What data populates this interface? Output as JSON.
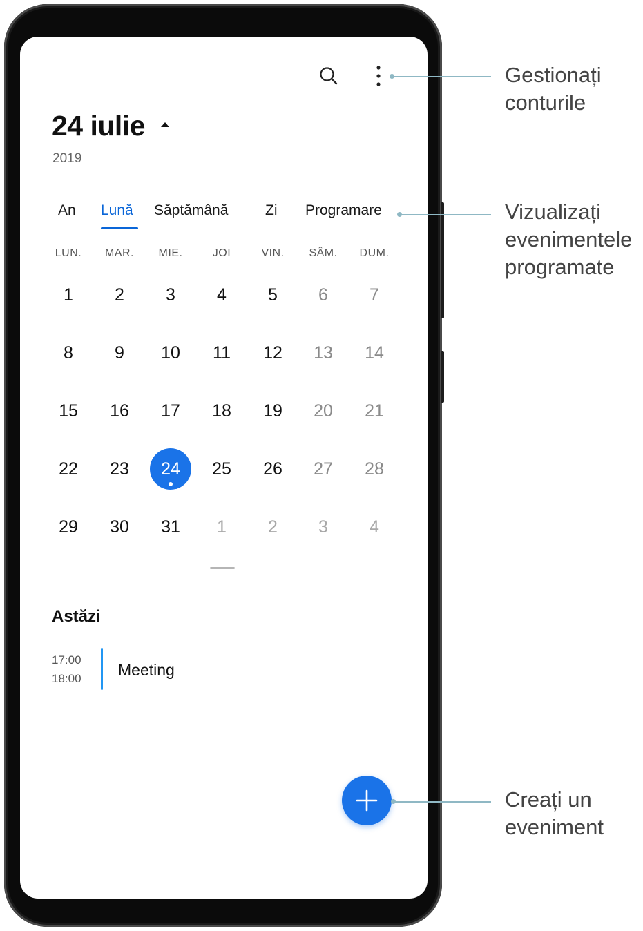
{
  "header": {
    "month_title": "24 iulie",
    "year": "2019"
  },
  "tabs": [
    {
      "label": "An"
    },
    {
      "label": "Lună",
      "active": true
    },
    {
      "label": "Săptămână"
    },
    {
      "label": "Zi"
    },
    {
      "label": "Programare"
    }
  ],
  "weekdays": [
    "LUN.",
    "MAR.",
    "MIE.",
    "JOI",
    "VIN.",
    "SÂM.",
    "DUM."
  ],
  "weeks": [
    [
      "1",
      "2",
      "3",
      "4",
      "5",
      "6",
      "7"
    ],
    [
      "8",
      "9",
      "10",
      "11",
      "12",
      "13",
      "14"
    ],
    [
      "15",
      "16",
      "17",
      "18",
      "19",
      "20",
      "21"
    ],
    [
      "22",
      "23",
      "24",
      "25",
      "26",
      "27",
      "28"
    ],
    [
      "29",
      "30",
      "31",
      "1",
      "2",
      "3",
      "4"
    ]
  ],
  "selected_day": "24",
  "today": {
    "title": "Astăzi",
    "events": [
      {
        "start": "17:00",
        "end": "18:00",
        "title": "Meeting"
      }
    ]
  },
  "icons": {
    "search": "search-icon",
    "more": "more-vertical-icon",
    "add": "plus-icon"
  },
  "colors": {
    "accent": "#1a73e8",
    "tab_active": "#0a66d8",
    "event_bar": "#2196f3",
    "callout_line": "#8fb8c4"
  },
  "callouts": {
    "manage_accounts": [
      "Gestionați",
      "conturile"
    ],
    "view_scheduled": [
      "Vizualizați",
      "evenimentele",
      "programate"
    ],
    "create_event": [
      "Creați un",
      "eveniment"
    ]
  }
}
